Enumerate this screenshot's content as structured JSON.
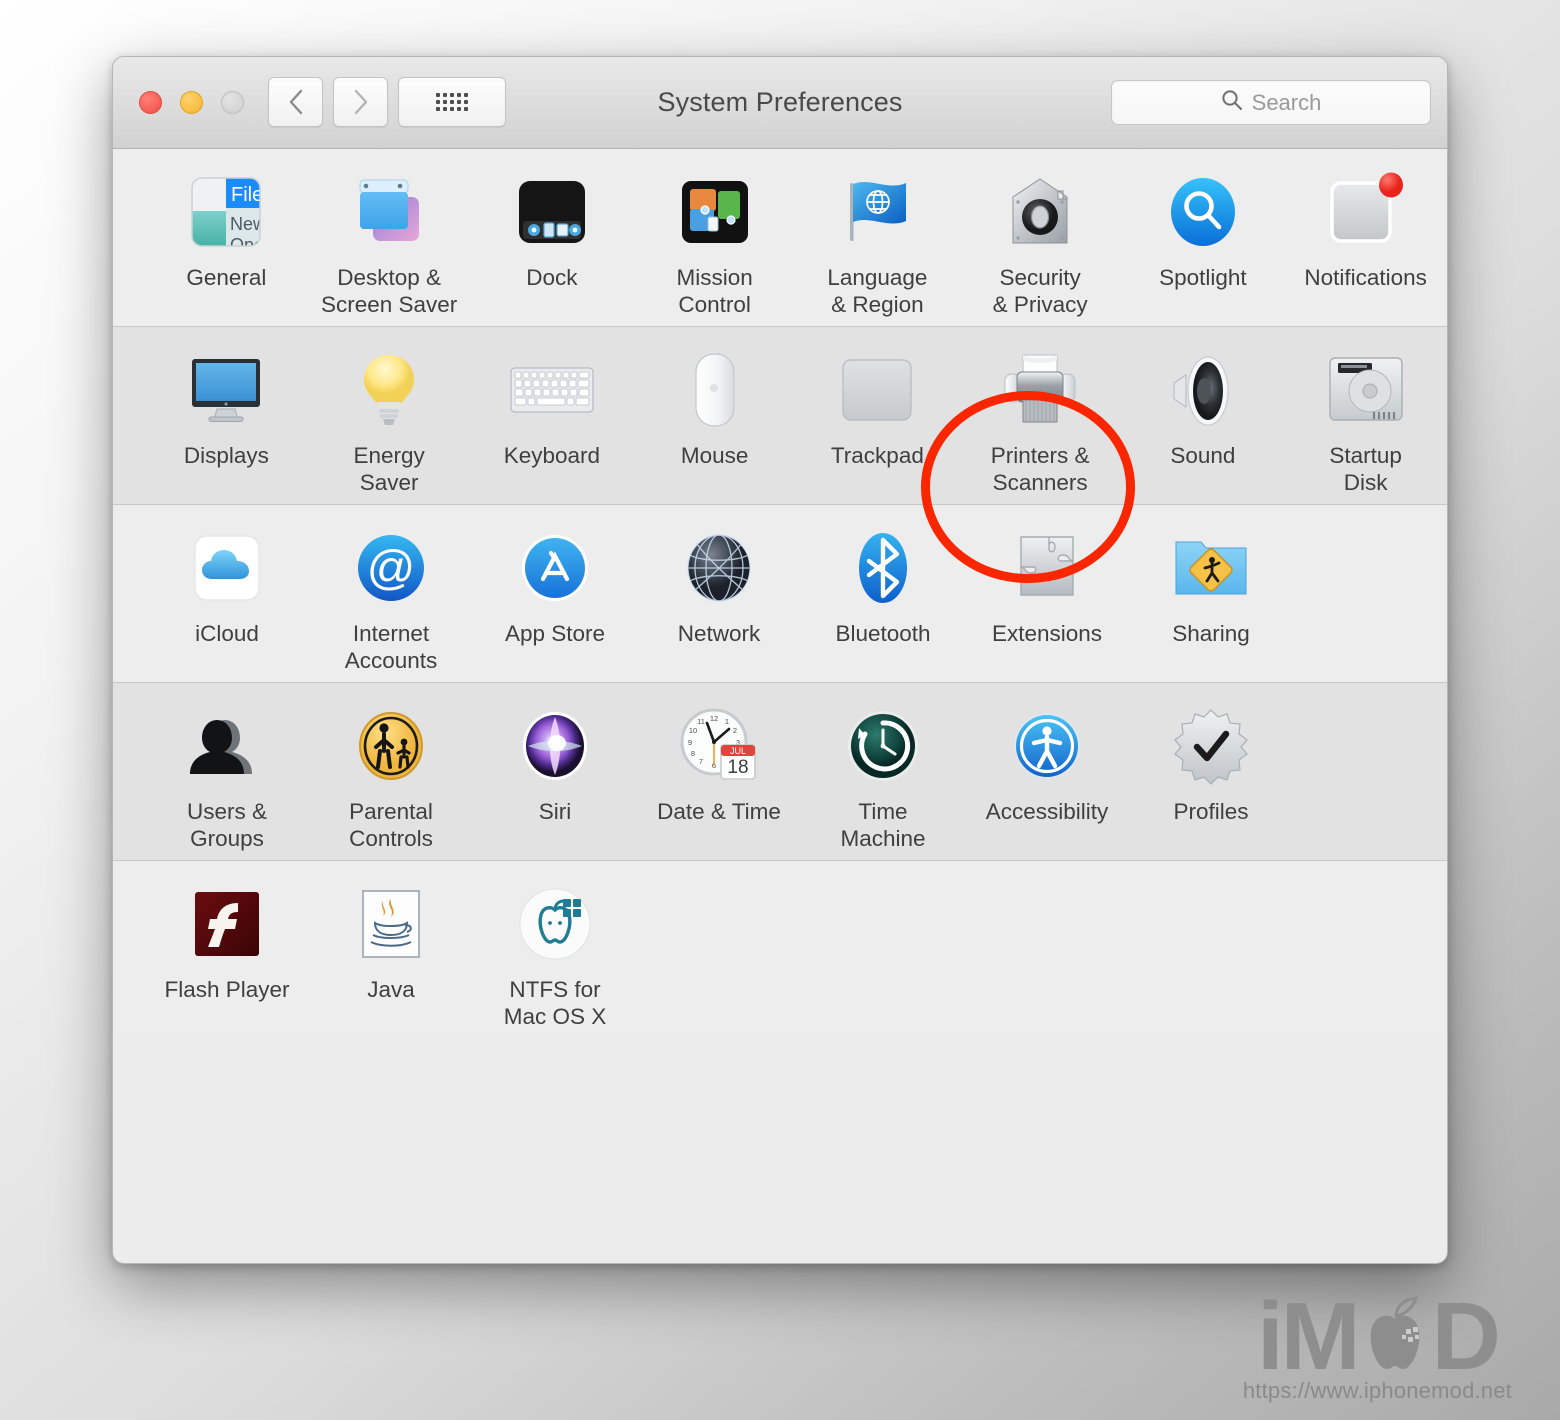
{
  "window": {
    "title": "System Preferences",
    "traffic_lights": [
      "close",
      "minimize",
      "zoom"
    ],
    "back_label": "Back",
    "forward_label": "Forward",
    "showall_label": "Show All"
  },
  "search": {
    "placeholder": "Search",
    "icon": "search-icon"
  },
  "rows": [
    {
      "shade": "light",
      "items": [
        {
          "icon": "general-icon",
          "label": "General"
        },
        {
          "icon": "desktop-saver-icon",
          "label": "Desktop &\nScreen Saver"
        },
        {
          "icon": "dock-icon",
          "label": "Dock"
        },
        {
          "icon": "mission-control-icon",
          "label": "Mission\nControl"
        },
        {
          "icon": "language-region-icon",
          "label": "Language\n& Region"
        },
        {
          "icon": "security-privacy-icon",
          "label": "Security\n& Privacy"
        },
        {
          "icon": "spotlight-icon",
          "label": "Spotlight"
        },
        {
          "icon": "notifications-icon",
          "label": "Notifications"
        }
      ]
    },
    {
      "shade": "dark",
      "items": [
        {
          "icon": "displays-icon",
          "label": "Displays"
        },
        {
          "icon": "energy-saver-icon",
          "label": "Energy\nSaver"
        },
        {
          "icon": "keyboard-icon",
          "label": "Keyboard"
        },
        {
          "icon": "mouse-icon",
          "label": "Mouse"
        },
        {
          "icon": "trackpad-icon",
          "label": "Trackpad"
        },
        {
          "icon": "printers-scanners-icon",
          "label": "Printers &\nScanners"
        },
        {
          "icon": "sound-icon",
          "label": "Sound"
        },
        {
          "icon": "startup-disk-icon",
          "label": "Startup\nDisk"
        }
      ]
    },
    {
      "shade": "light",
      "items": [
        {
          "icon": "icloud-icon",
          "label": "iCloud"
        },
        {
          "icon": "internet-accounts-icon",
          "label": "Internet\nAccounts"
        },
        {
          "icon": "app-store-icon",
          "label": "App Store"
        },
        {
          "icon": "network-icon",
          "label": "Network"
        },
        {
          "icon": "bluetooth-icon",
          "label": "Bluetooth"
        },
        {
          "icon": "extensions-icon",
          "label": "Extensions"
        },
        {
          "icon": "sharing-icon",
          "label": "Sharing"
        }
      ]
    },
    {
      "shade": "dark",
      "items": [
        {
          "icon": "users-groups-icon",
          "label": "Users &\nGroups"
        },
        {
          "icon": "parental-controls-icon",
          "label": "Parental\nControls"
        },
        {
          "icon": "siri-icon",
          "label": "Siri"
        },
        {
          "icon": "date-time-icon",
          "label": "Date & Time"
        },
        {
          "icon": "time-machine-icon",
          "label": "Time\nMachine"
        },
        {
          "icon": "accessibility-icon",
          "label": "Accessibility"
        },
        {
          "icon": "profiles-icon",
          "label": "Profiles"
        }
      ]
    },
    {
      "shade": "light",
      "items": [
        {
          "icon": "flash-player-icon",
          "label": "Flash Player"
        },
        {
          "icon": "java-icon",
          "label": "Java"
        },
        {
          "icon": "ntfs-mac-icon",
          "label": "NTFS for\nMac OS X"
        }
      ]
    }
  ],
  "annotation": {
    "shape": "ellipse",
    "color": "#fa2600",
    "targets": "Printers & Scanners"
  },
  "icon_details": {
    "general_text": [
      "File",
      "New",
      "Open"
    ],
    "date_time_month": "JUL",
    "date_time_day": "18"
  },
  "watermark": {
    "logo_left": "iM",
    "logo_right": "D",
    "url": "https://www.iphonemod.net"
  }
}
